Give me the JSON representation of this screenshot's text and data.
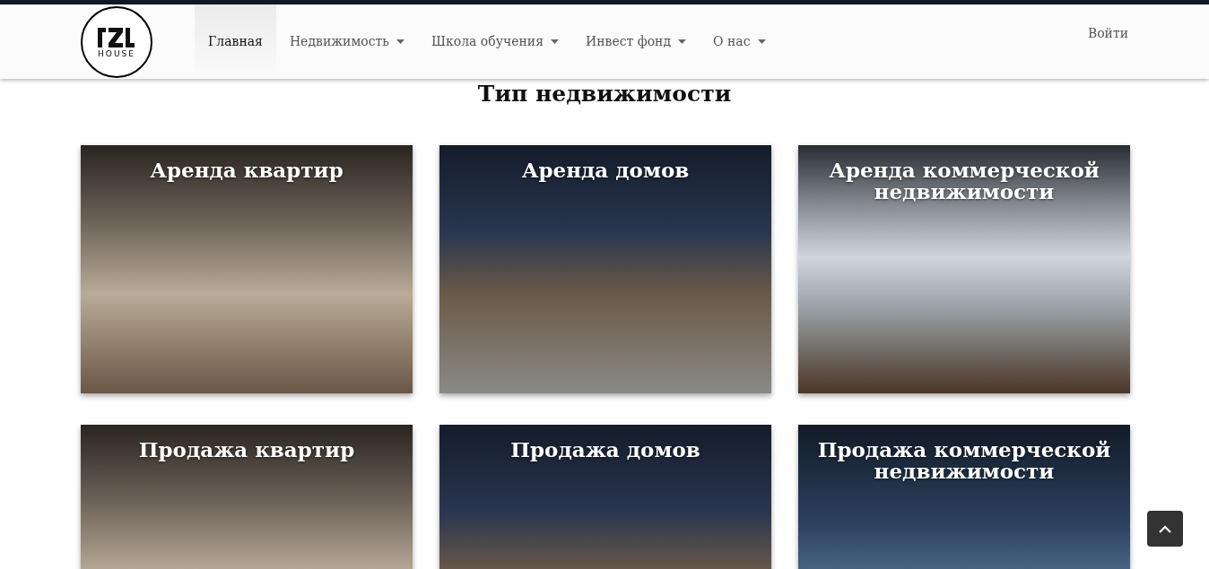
{
  "logo": {
    "text": "HOUSE"
  },
  "nav": [
    {
      "label": "Главная",
      "selected": true,
      "dropdown": false
    },
    {
      "label": "Недвижимость",
      "selected": false,
      "dropdown": true
    },
    {
      "label": "Школа обучения",
      "selected": false,
      "dropdown": true
    },
    {
      "label": "Инвест фонд",
      "selected": false,
      "dropdown": true
    },
    {
      "label": "О нас",
      "selected": false,
      "dropdown": true
    }
  ],
  "login": "Войти",
  "heading": "Тип недвижимости",
  "cards": [
    {
      "title": "Аренда квартир",
      "kind": "interior"
    },
    {
      "title": "Аренда домов",
      "kind": "house"
    },
    {
      "title": "Аренда коммерческой недвижимости",
      "kind": "office"
    },
    {
      "title": "Продажа квартир",
      "kind": "interior"
    },
    {
      "title": "Продажа домов",
      "kind": "house"
    },
    {
      "title": "Продажа коммерческой недвижимости",
      "kind": "tower"
    }
  ]
}
